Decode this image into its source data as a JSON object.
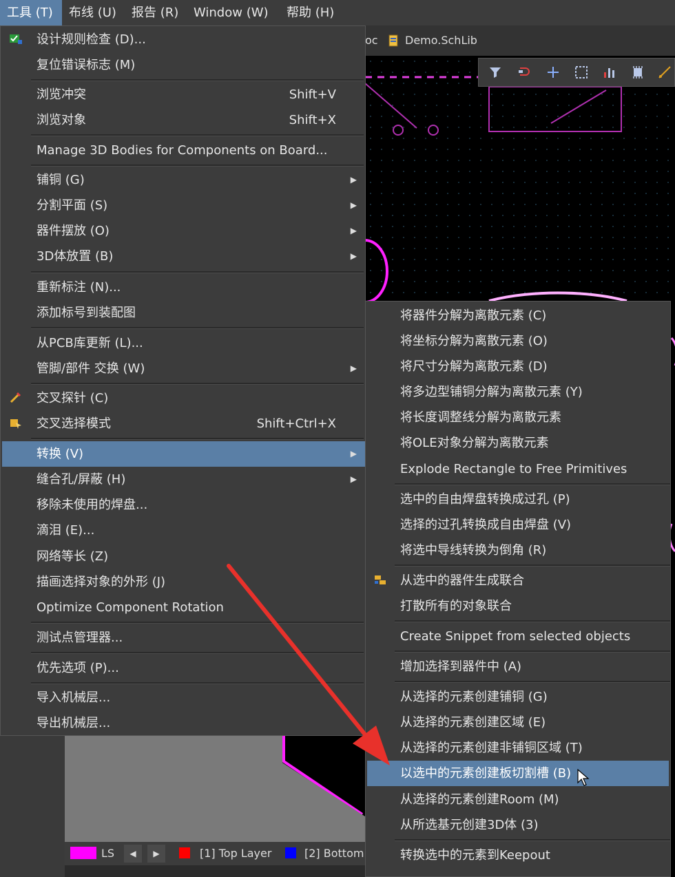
{
  "menubar": {
    "items": [
      {
        "label": "工具 (T)",
        "active": true
      },
      {
        "label": "布线 (U)"
      },
      {
        "label": "报告 (R)"
      },
      {
        "label": "Window (W)"
      },
      {
        "label": "帮助 (H)"
      }
    ]
  },
  "document": {
    "tab_partial": "oc",
    "tab_schlib": "Demo.SchLib"
  },
  "toolbar": {
    "icons": [
      "filter-icon",
      "route-icon",
      "add-icon",
      "select-rect-icon",
      "chart-icon",
      "component-icon",
      "draw-icon"
    ]
  },
  "tools_menu": {
    "items": [
      {
        "label": "设计规则检查 (D)...",
        "icon": "drc-icon"
      },
      {
        "label": "复位错误标志 (M)"
      },
      {
        "label": "浏览冲突",
        "shortcut": "Shift+V"
      },
      {
        "label": "浏览对象",
        "shortcut": "Shift+X"
      },
      {
        "label": "Manage 3D Bodies for Components on Board..."
      },
      {
        "label": "铺铜 (G)",
        "submenu": true
      },
      {
        "label": "分割平面 (S)",
        "submenu": true
      },
      {
        "label": "器件摆放 (O)",
        "submenu": true
      },
      {
        "label": "3D体放置 (B)",
        "submenu": true
      },
      {
        "label": "重新标注 (N)..."
      },
      {
        "label": "添加标号到装配图"
      },
      {
        "label": "从PCB库更新 (L)..."
      },
      {
        "label": "管脚/部件 交换 (W)",
        "submenu": true
      },
      {
        "label": "交叉探针 (C)",
        "icon": "cross-probe-icon"
      },
      {
        "label": "交叉选择模式",
        "shortcut": "Shift+Ctrl+X",
        "icon": "cross-select-icon"
      },
      {
        "label": "转换 (V)",
        "submenu": true,
        "selected": true
      },
      {
        "label": "缝合孔/屏蔽 (H)",
        "submenu": true
      },
      {
        "label": "移除未使用的焊盘..."
      },
      {
        "label": "滴泪 (E)..."
      },
      {
        "label": "网络等长 (Z)"
      },
      {
        "label": "描画选择对象的外形 (J)"
      },
      {
        "label": "Optimize Component Rotation"
      },
      {
        "label": "测试点管理器..."
      },
      {
        "label": "优先选项 (P)..."
      },
      {
        "label": "导入机械层..."
      },
      {
        "label": "导出机械层..."
      }
    ]
  },
  "convert_submenu": {
    "items": [
      {
        "label": "将器件分解为离散元素 (C)"
      },
      {
        "label": "将坐标分解为离散元素 (O)"
      },
      {
        "label": "将尺寸分解为离散元素 (D)"
      },
      {
        "label": "将多边型铺铜分解为离散元素 (Y)"
      },
      {
        "label": "将长度调整线分解为离散元素"
      },
      {
        "label": "将OLE对象分解为离散元素"
      },
      {
        "label": "Explode Rectangle to Free Primitives"
      },
      {
        "label": "选中的自由焊盘转换成过孔 (P)"
      },
      {
        "label": "选择的过孔转换成自由焊盘 (V)"
      },
      {
        "label": "将选中导线转换为倒角 (R)"
      },
      {
        "label": "从选中的器件生成联合",
        "icon": "union-icon"
      },
      {
        "label": "打散所有的对象联合"
      },
      {
        "label": "Create Snippet from selected objects"
      },
      {
        "label": "增加选择到器件中 (A)"
      },
      {
        "label": "从选择的元素创建铺铜 (G)"
      },
      {
        "label": "从选择的元素创建区域 (E)"
      },
      {
        "label": "从选择的元素创建非铺铜区域 (T)"
      },
      {
        "label": "以选中的元素创建板切割槽 (B)",
        "selected": true
      },
      {
        "label": "从选择的元素创建Room (M)"
      },
      {
        "label": "从所选基元创建3D体 (3)"
      },
      {
        "label": "转换选中的元素到Keepout"
      }
    ]
  },
  "statusbar": {
    "ls": "LS",
    "layer1": "[1] Top Layer",
    "layer2": "[2] Bottom",
    "colors": {
      "ls": "#ff00ff",
      "layer1": "#ff0000",
      "layer2": "#0000ff"
    }
  },
  "colors": {
    "highlight": "#5a7fa6",
    "menu_bg": "#3c3c3c",
    "annotation_arrow": "#e8312b",
    "pcb_outline": "#e040e0"
  }
}
